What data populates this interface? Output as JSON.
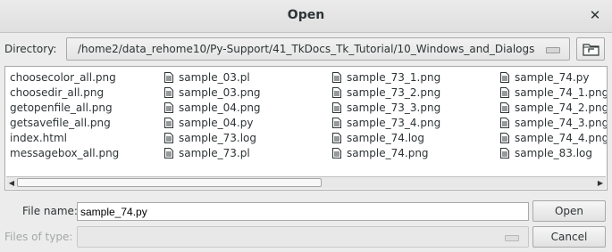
{
  "window": {
    "title": "Open",
    "close_glyph": "✕"
  },
  "directory": {
    "label": "Directory:",
    "path": "/home2/data_rehome10/Py-Support/41_TkDocs_Tk_Tutorial/10_Windows_and_Dialogs"
  },
  "files": {
    "col1": [
      {
        "name": "choosecolor_all.png",
        "icon": "none"
      },
      {
        "name": "choosedir_all.png",
        "icon": "none"
      },
      {
        "name": "getopenfile_all.png",
        "icon": "none"
      },
      {
        "name": "getsavefile_all.png",
        "icon": "none"
      },
      {
        "name": "index.html",
        "icon": "none"
      },
      {
        "name": "messagebox_all.png",
        "icon": "none"
      }
    ],
    "col2": [
      {
        "name": "sample_03.pl",
        "icon": "file-icon"
      },
      {
        "name": "sample_03.png",
        "icon": "file-icon"
      },
      {
        "name": "sample_04.png",
        "icon": "file-icon"
      },
      {
        "name": "sample_04.py",
        "icon": "file-icon"
      },
      {
        "name": "sample_73.log",
        "icon": "file-icon"
      },
      {
        "name": "sample_73.pl",
        "icon": "file-icon"
      }
    ],
    "col3": [
      {
        "name": "sample_73_1.png",
        "icon": "file-icon"
      },
      {
        "name": "sample_73_2.png",
        "icon": "file-icon"
      },
      {
        "name": "sample_73_3.png",
        "icon": "file-icon"
      },
      {
        "name": "sample_73_4.png",
        "icon": "file-icon"
      },
      {
        "name": "sample_74.log",
        "icon": "file-icon"
      },
      {
        "name": "sample_74.png",
        "icon": "file-icon"
      }
    ],
    "col4": [
      {
        "name": "sample_74.py",
        "icon": "file-icon"
      },
      {
        "name": "sample_74_1.png",
        "icon": "file-icon"
      },
      {
        "name": "sample_74_2.png",
        "icon": "file-icon"
      },
      {
        "name": "sample_74_3.png",
        "icon": "file-icon"
      },
      {
        "name": "sample_74_4.png",
        "icon": "file-icon"
      },
      {
        "name": "sample_83.log",
        "icon": "file-icon"
      }
    ]
  },
  "scrollbar": {
    "left_arrow": "◀",
    "right_arrow": "▶"
  },
  "filename": {
    "label": "File name:",
    "value": "sample_74.py"
  },
  "filetype": {
    "label": "Files of type:",
    "value": ""
  },
  "buttons": {
    "open": "Open",
    "cancel": "Cancel"
  },
  "colors": {
    "background": "#ececec",
    "list_background": "#ffffff",
    "border": "#a9a9a9",
    "disabled_text": "#a5a8a8"
  }
}
